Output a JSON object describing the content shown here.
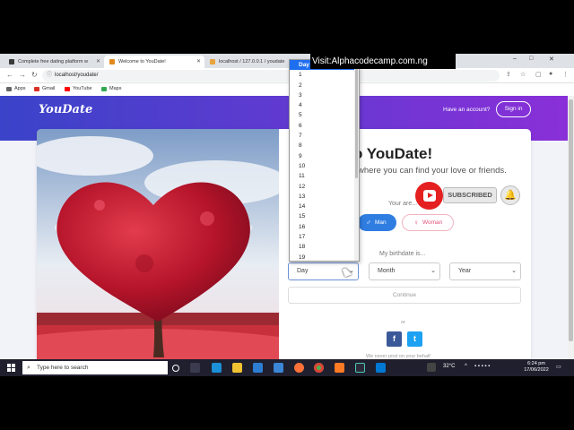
{
  "browser": {
    "tabs": [
      {
        "title": "Complete free dating platform w",
        "favicon_color": "#3a3a3a",
        "active": false
      },
      {
        "title": "Welcome to YouDate!",
        "favicon_color": "#e08a1e",
        "active": true
      },
      {
        "title": "localhost / 127.0.0.1 / youdate",
        "favicon_color": "#e8a33c",
        "active": false
      }
    ],
    "new_tab": "+",
    "window_controls": {
      "minimize": "–",
      "restore": "□",
      "close": "✕"
    },
    "nav": {
      "back": "←",
      "forward": "→",
      "reload": "↻"
    },
    "url": "localhost/youdate/",
    "bookmarks": [
      {
        "label": "Apps",
        "icon_color": "#666666"
      },
      {
        "label": "Gmail",
        "icon_color": "#d93025"
      },
      {
        "label": "YouTube",
        "icon_color": "#ff0000"
      },
      {
        "label": "Maps",
        "icon_color": "#34a853"
      }
    ]
  },
  "overlay": {
    "banner_text": "Visit:Alphacodecamp.com.ng",
    "subscribed_label": "SUBSCRIBED",
    "bell": "🔔"
  },
  "site": {
    "logo": "YouDate",
    "have_account": "Have an account?",
    "signin_label": "Sign in",
    "welcome": "o YouDate!",
    "tagline": "where you can find your love or friends.",
    "your_are": "Your are...",
    "gender": {
      "man": "Man",
      "woman": "Woman",
      "man_icon": "♂",
      "woman_icon": "♀"
    },
    "birthdate_label": "My birthdate is...",
    "selects": {
      "day": "Day",
      "month": "Month",
      "year": "Year",
      "chevron": "⌄"
    },
    "continue_label": "Continue",
    "or": "or",
    "social": {
      "facebook": "f",
      "twitter": "t"
    },
    "never_post": "We never post on your behalf"
  },
  "day_dropdown": {
    "selected": "Day",
    "options": [
      "Day",
      "1",
      "2",
      "3",
      "4",
      "5",
      "6",
      "7",
      "8",
      "9",
      "10",
      "11",
      "12",
      "13",
      "14",
      "15",
      "16",
      "17",
      "18",
      "19"
    ]
  },
  "taskbar": {
    "search_placeholder": "Type here to search",
    "temperature": "32°C",
    "time": "6:24 pm",
    "date": "17/06/2022"
  },
  "colors": {
    "header_gradient_start": "#3a43c9",
    "header_gradient_end": "#8b2fd8",
    "man_button": "#2f7de1",
    "woman_accent": "#e0527b",
    "dropdown_highlight": "#1e6ef0"
  }
}
